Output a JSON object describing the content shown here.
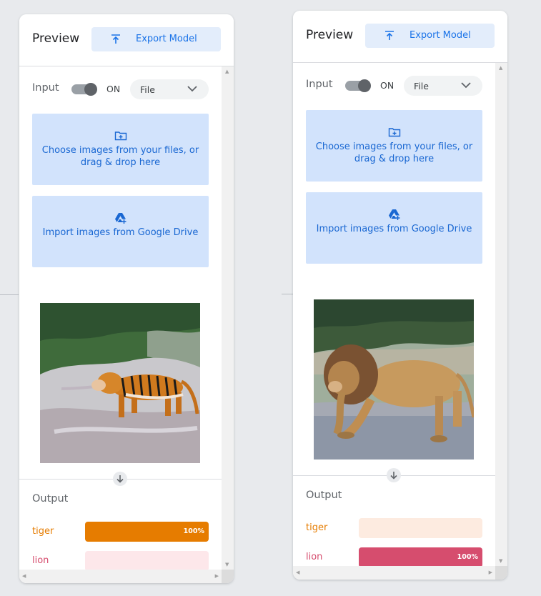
{
  "panels": [
    {
      "title": "Preview",
      "export_label": "Export Model",
      "input_label": "Input",
      "toggle_state": "ON",
      "source_select": "File",
      "upload_files_text": "Choose images from your files, or drag & drop here",
      "upload_drive_text": "Import images from Google Drive",
      "image_subject": "tiger",
      "output_label": "Output",
      "classes": [
        {
          "name": "tiger",
          "confidence": 1.0,
          "confidence_text": "100%",
          "color": "#e67c00",
          "track_color": "#fde9d6"
        },
        {
          "name": "lion",
          "confidence": 0.0,
          "confidence_text": "",
          "color": "#d64d6e",
          "track_color": "#fde7ea"
        }
      ]
    },
    {
      "title": "Preview",
      "export_label": "Export Model",
      "input_label": "Input",
      "toggle_state": "ON",
      "source_select": "File",
      "upload_files_text": "Choose images from your files, or drag & drop here",
      "upload_drive_text": "Import images from Google Drive",
      "image_subject": "lion",
      "output_label": "Output",
      "classes": [
        {
          "name": "tiger",
          "confidence": 0.0,
          "confidence_text": "",
          "color": "#e67c00",
          "track_color": "#fdebe0"
        },
        {
          "name": "lion",
          "confidence": 1.0,
          "confidence_text": "100%",
          "color": "#d64d6e",
          "track_color": "#fde7ea"
        }
      ]
    }
  ],
  "colors": {
    "accent": "#1a73e8",
    "upload_bg": "#d2e3fc",
    "export_bg": "#e3edfb",
    "tiger": "#e67c00",
    "lion": "#d64d6e"
  }
}
